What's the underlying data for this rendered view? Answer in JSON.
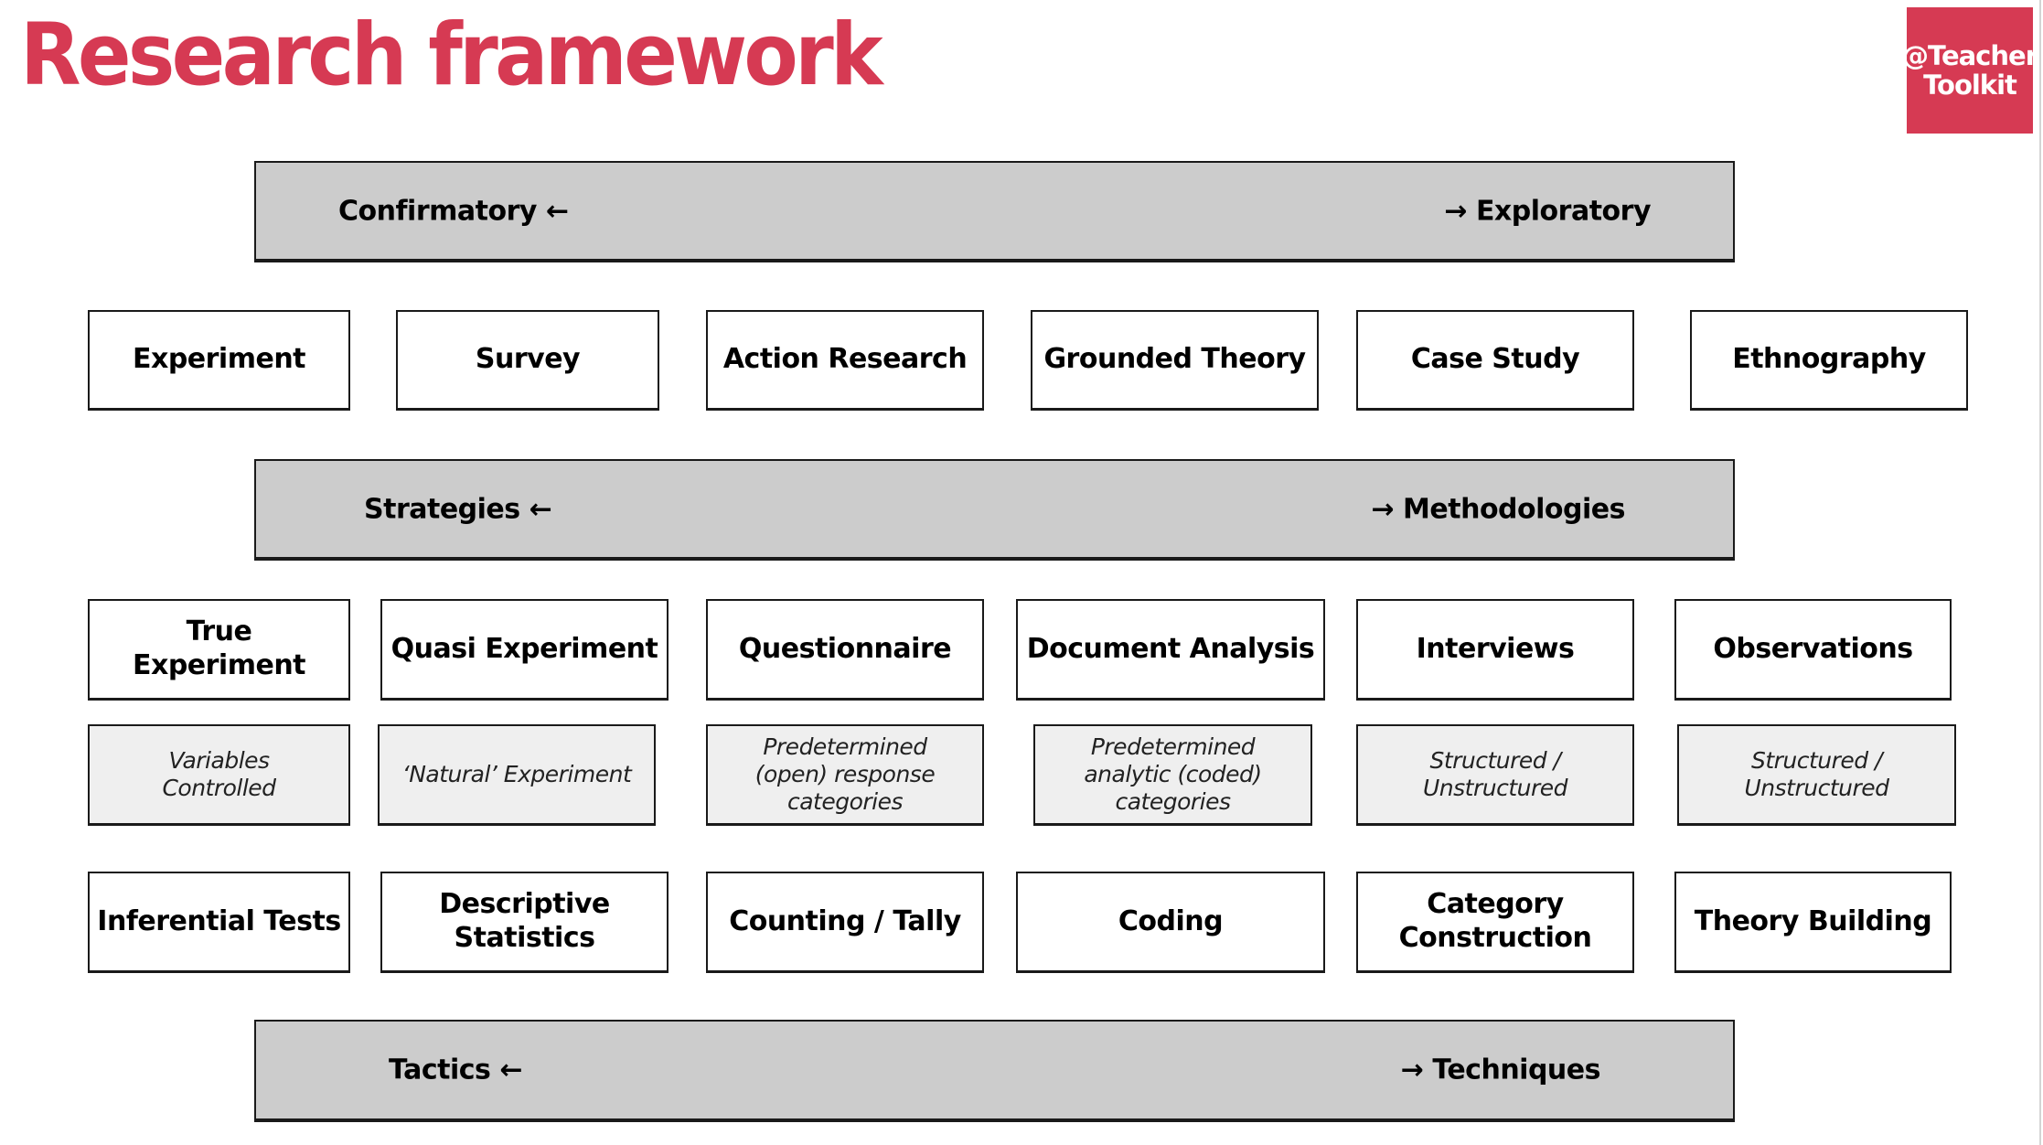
{
  "title": "Research framework",
  "logo": {
    "line1": "@Teacher",
    "line2": "Toolkit"
  },
  "colors": {
    "accent": "#d63a53",
    "bar_fill": "#cccccc",
    "sub_fill": "#efefef",
    "border": "#1a1a1a"
  },
  "bars": {
    "top": {
      "left": "Confirmatory ←",
      "right": "→ Exploratory"
    },
    "middle": {
      "left": "Strategies ←",
      "right": "→ Methodologies"
    },
    "bottom": {
      "left": "Tactics ←",
      "right": "→ Techniques"
    }
  },
  "methodologies": [
    "Experiment",
    "Survey",
    "Action Research",
    "Grounded Theory",
    "Case Study",
    "Ethnography"
  ],
  "methods": [
    "True Experiment",
    "Quasi Experiment",
    "Questionnaire",
    "Document Analysis",
    "Interviews",
    "Observations"
  ],
  "method_notes": [
    "Variables Controlled",
    "‘Natural’ Experiment",
    "Predetermined (open) response categories",
    "Predetermined analytic (coded) categories",
    "Structured / Unstructured",
    "Structured / Unstructured"
  ],
  "techniques": [
    "Inferential Tests",
    "Descriptive Statistics",
    "Counting / Tally",
    "Coding",
    "Category Construction",
    "Theory Building"
  ]
}
